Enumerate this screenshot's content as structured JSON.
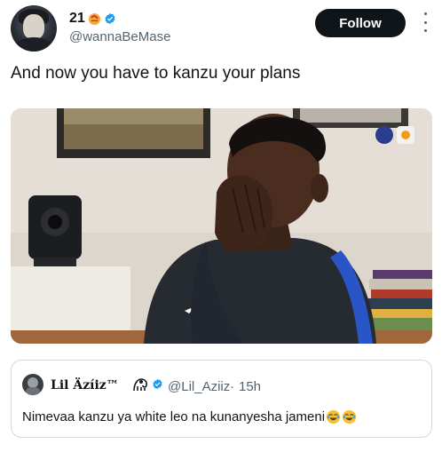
{
  "author": {
    "name": "21",
    "name_emoji": "100-emoji-icon",
    "verified": true,
    "handle": "@wannaBeMase"
  },
  "actions": {
    "follow_label": "Follow",
    "more_icon": "more-vertical-icon"
  },
  "tweet": {
    "text": "And now you have to kanzu your plans"
  },
  "media": {
    "type": "video-still",
    "logos": [
      "fff-logo-icon",
      "edf-logo-icon"
    ]
  },
  "quoted_tweet": {
    "name": "Lil Äzíiz™",
    "name_icon": "lion-emblem-icon",
    "verified": true,
    "handle": "@Lil_Aziiz",
    "separator": "·",
    "time": "15h",
    "text": "Nimevaa kanzu ya white leo na kunanyesha jameni",
    "trailing_emoji": [
      "laughing-emoji-icon",
      "laughing-emoji-icon"
    ]
  },
  "colors": {
    "text": "#0f1419",
    "secondary": "#536471",
    "verified": "#1d9bf0",
    "border": "#cfd9de",
    "follow_bg": "#0f1419"
  }
}
